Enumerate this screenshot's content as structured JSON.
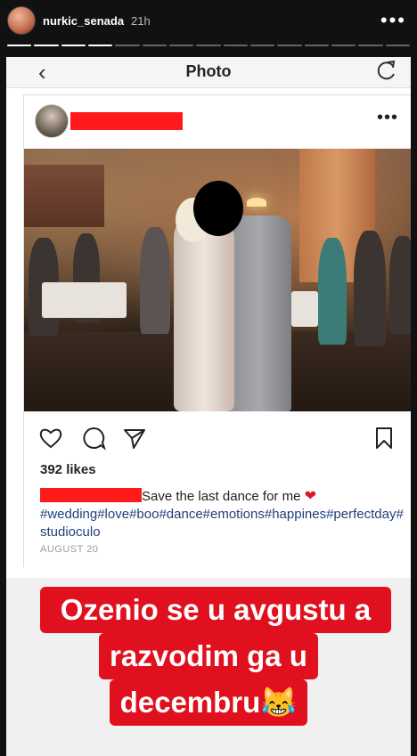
{
  "story": {
    "username": "nurkic_senada",
    "time": "21h",
    "more_label": "•••"
  },
  "app_bar": {
    "back_icon": "chevron-left-icon",
    "title": "Photo",
    "refresh_icon": "refresh-icon"
  },
  "post": {
    "more_label": "•••",
    "likes": "392 likes",
    "caption": "Save the last dance for me",
    "caption_emoji": "❤",
    "hashtags": "#wedding#love#boo#dance#emotions#happines#perfectday#studioculo",
    "date": "AUGUST 20",
    "action_icons": [
      "heart-icon",
      "comment-icon",
      "share-icon",
      "bookmark-icon"
    ]
  },
  "overlay": {
    "line1": "Ozenio se u avgustu a",
    "line2": "razvodim ga u",
    "line3": "decembru",
    "emoji": "😹"
  },
  "colors": {
    "redaction": "#ff1b1b",
    "overlay_bg": "#e1101e",
    "hashtag": "#1f3f7a"
  }
}
